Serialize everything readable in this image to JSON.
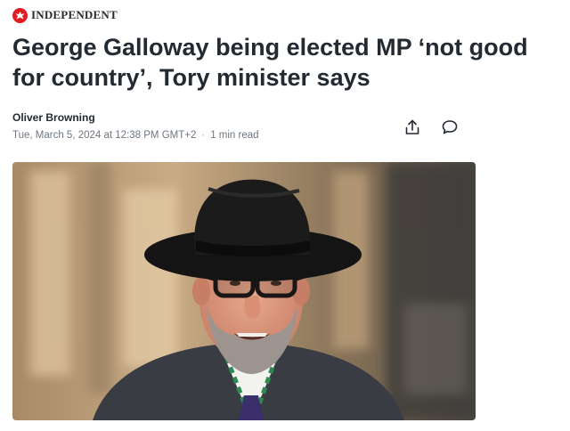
{
  "publisher": {
    "name": "INDEPENDENT",
    "logo_icon": "eagle-icon",
    "brand_color": "#e01b22"
  },
  "article": {
    "headline": "George Galloway being elected MP ‘not good for country’, Tory minister says",
    "author": "Oliver Browning",
    "date": "Tue, March 5, 2024 at 12:38 PM GMT+2",
    "separator": "·",
    "read_time": "1 min read",
    "hero_image": "photo of a smiling man with grey beard wearing a black fedora hat and glasses"
  },
  "actions": [
    {
      "name": "share",
      "icon": "share-icon"
    },
    {
      "name": "comments",
      "icon": "comment-icon"
    }
  ]
}
